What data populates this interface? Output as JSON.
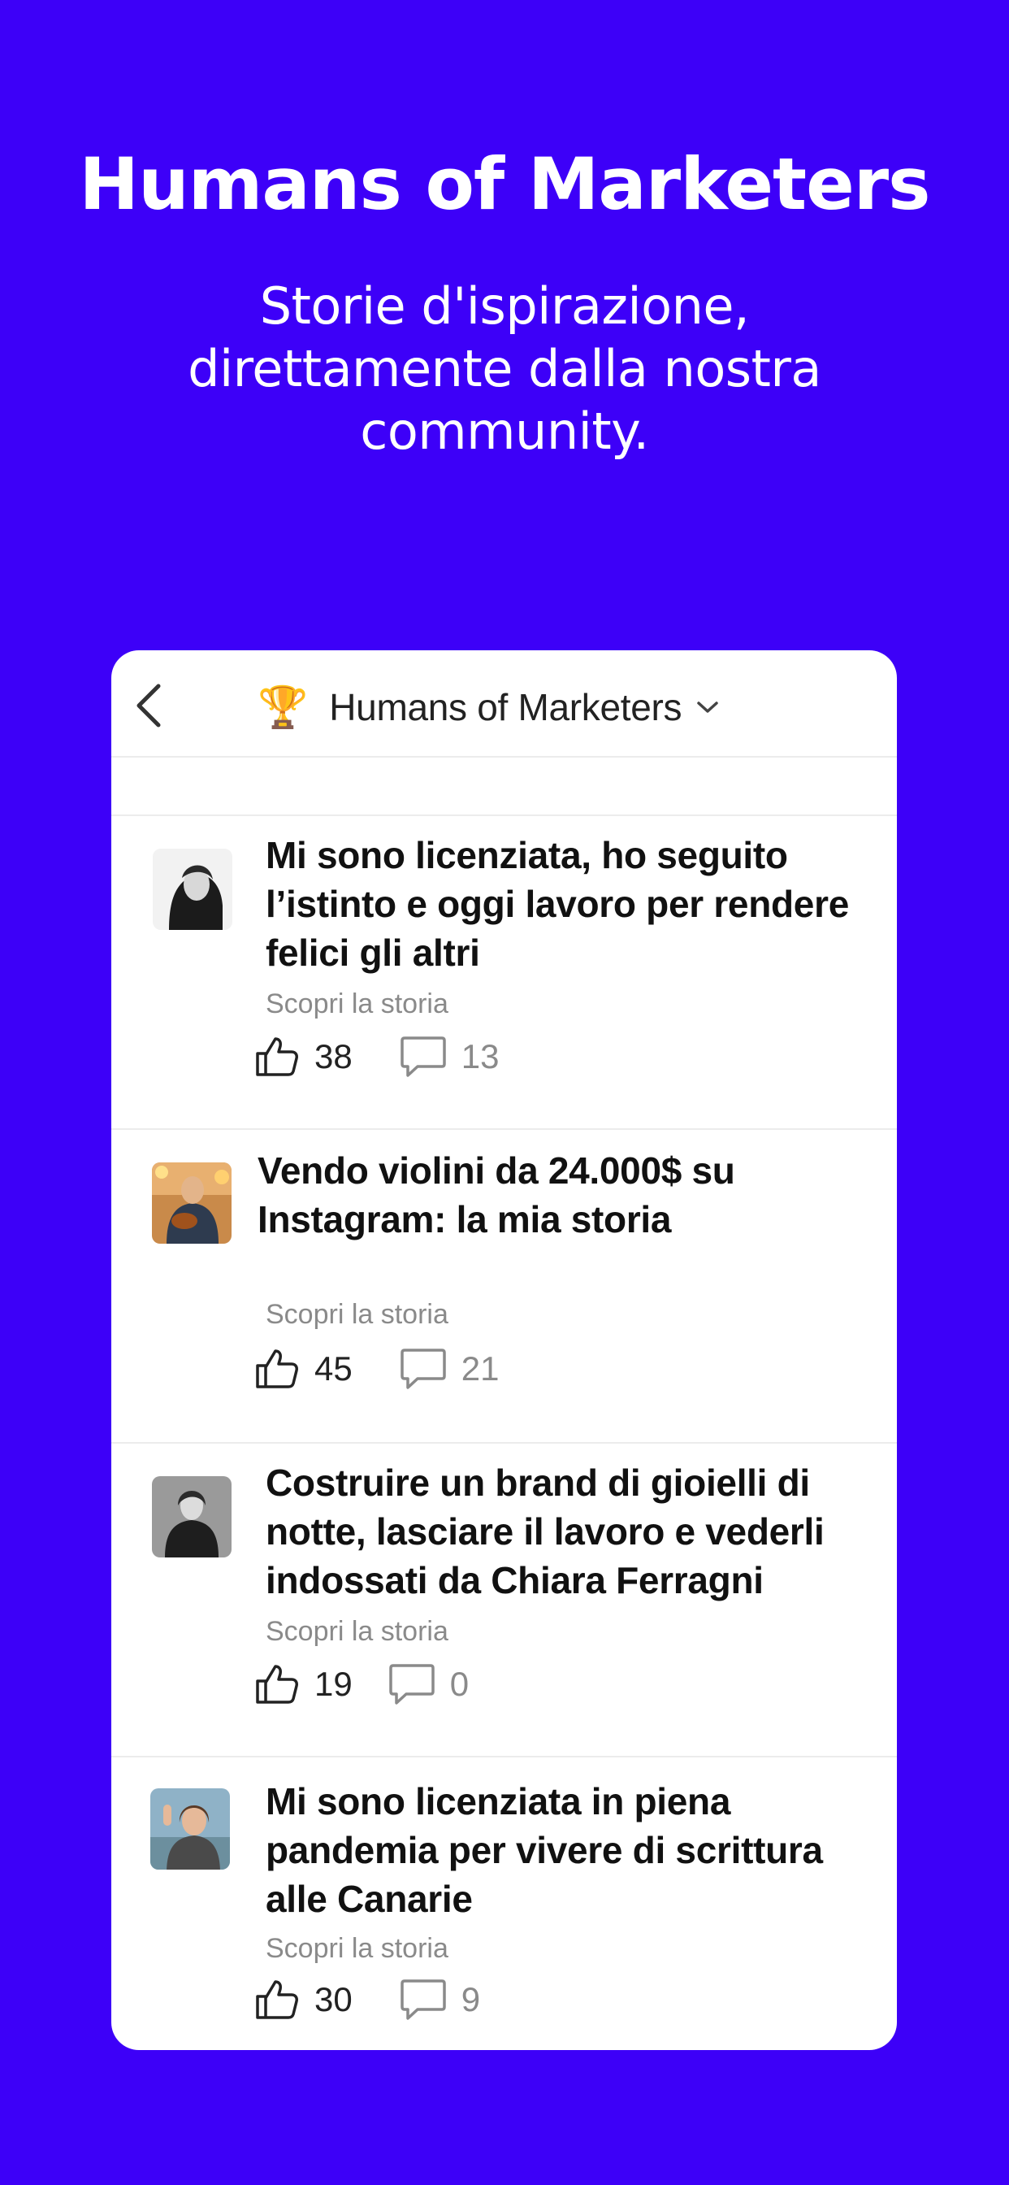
{
  "hero": {
    "title": "Humans of Marketers",
    "subtitle": "Storie d'ispirazione, direttamente dalla nostra community."
  },
  "header": {
    "back_icon": "chevron-left-icon",
    "trophy": "🏆",
    "title": "Humans of Marketers",
    "dropdown_icon": "chevron-down-icon"
  },
  "colors": {
    "background": "#3d00f8",
    "card": "#ffffff",
    "title_text": "#111111",
    "muted_text": "#8a8a8a"
  },
  "stories": [
    {
      "title": "Mi sono licenziata, ho seguito l’istinto e oggi lavoro per rendere felici gli altri",
      "link": "Scopri la storia",
      "likes": "38",
      "comments": "13",
      "avatar": "woman-portrait-bw"
    },
    {
      "title": "Vendo violini da 24.000$ su Instagram: la mia storia",
      "link": "Scopri la storia",
      "likes": "45",
      "comments": "21",
      "avatar": "man-with-violin"
    },
    {
      "title": "Costruire un brand di gioielli di notte, lasciare il lavoro e vederli indossati da Chiara Ferragni",
      "link": "Scopri la storia",
      "likes": "19",
      "comments": "0",
      "avatar": "woman-portrait-bw"
    },
    {
      "title": "Mi sono licenziata in piena pandemia per vivere di scrittura alle Canarie",
      "link": "Scopri la storia",
      "likes": "30",
      "comments": "9",
      "avatar": "woman-smiling-outdoors"
    }
  ]
}
